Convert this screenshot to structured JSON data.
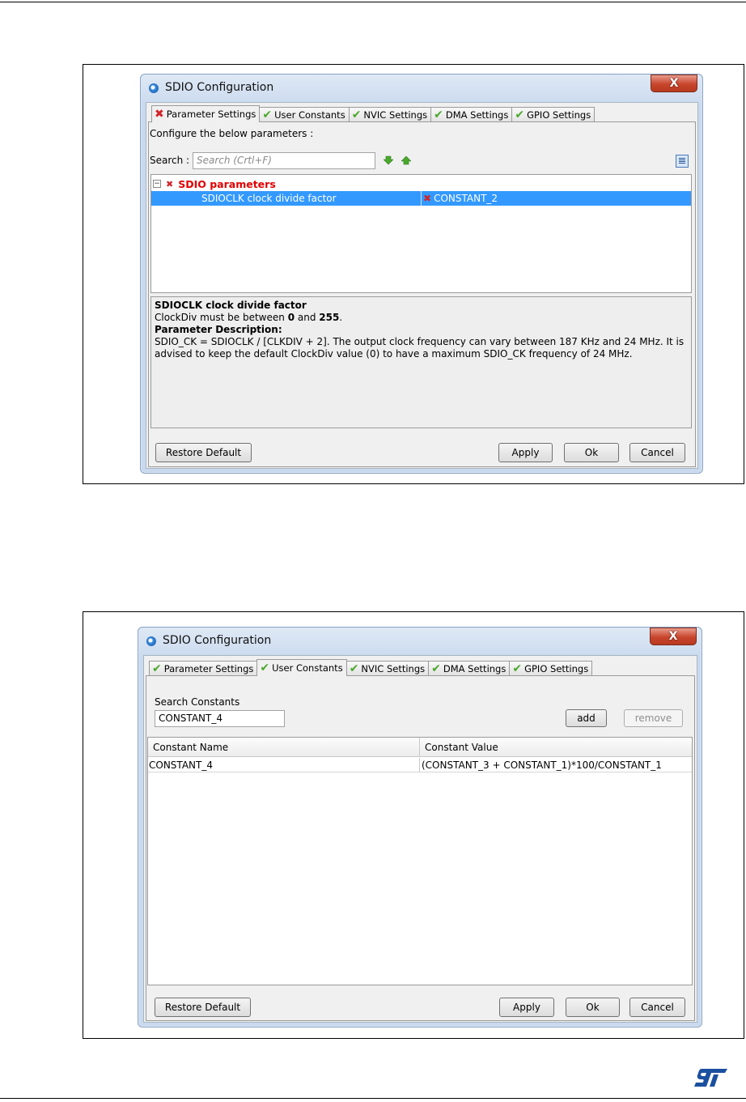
{
  "figure1": {
    "dialog_title": "SDIO Configuration",
    "close_label": "X",
    "tabs": [
      {
        "label": "Parameter Settings",
        "status": "error"
      },
      {
        "label": "User Constants",
        "status": "ok"
      },
      {
        "label": "NVIC Settings",
        "status": "ok"
      },
      {
        "label": "DMA Settings",
        "status": "ok"
      },
      {
        "label": "GPIO Settings",
        "status": "ok"
      }
    ],
    "intro": "Configure the below parameters :",
    "search_label": "Search :",
    "search_placeholder": "Search (Crtl+F)",
    "tree_group": "SDIO parameters",
    "selected_param": {
      "name": "SDIOCLK clock divide factor",
      "value": "CONSTANT_2"
    },
    "description": {
      "title": "SDIOCLK clock divide factor",
      "range_prefix": "ClockDiv must be between ",
      "range_min": "0",
      "range_and": " and ",
      "range_max": "255",
      "range_end": ".",
      "param_heading": "Parameter Description:",
      "text_line1": "SDIO_CK = SDIOCLK / [CLKDIV + 2]. The output clock frequency can vary between 187 KHz and 24 MHz. It is",
      "text_line2": "advised to keep the default ClockDiv value (0) to have a maximum SDIO_CK frequency of 24 MHz."
    },
    "buttons": {
      "restore": "Restore Default",
      "apply": "Apply",
      "ok": "Ok",
      "cancel": "Cancel"
    }
  },
  "figure2": {
    "dialog_title": "SDIO Configuration",
    "close_label": "X",
    "tabs": [
      {
        "label": "Parameter Settings",
        "status": "ok"
      },
      {
        "label": "User Constants",
        "status": "ok"
      },
      {
        "label": "NVIC Settings",
        "status": "ok"
      },
      {
        "label": "DMA Settings",
        "status": "ok"
      },
      {
        "label": "GPIO Settings",
        "status": "ok"
      }
    ],
    "search_label": "Search Constants",
    "search_value": "CONSTANT_4",
    "add_label": "add",
    "remove_label": "remove",
    "table": {
      "columns": [
        "Constant Name",
        "Constant Value"
      ],
      "rows": [
        [
          "CONSTANT_4",
          "(CONSTANT_3 + CONSTANT_1)*100/CONSTANT_1"
        ]
      ]
    },
    "buttons": {
      "restore": "Restore Default",
      "apply": "Apply",
      "ok": "Ok",
      "cancel": "Cancel"
    }
  },
  "footer": {
    "logo": "ST"
  },
  "colors": {
    "accent_selection": "#3399ff",
    "error_red": "#d3252a",
    "ok_green": "#4aa82c",
    "group_red": "#e00000"
  }
}
